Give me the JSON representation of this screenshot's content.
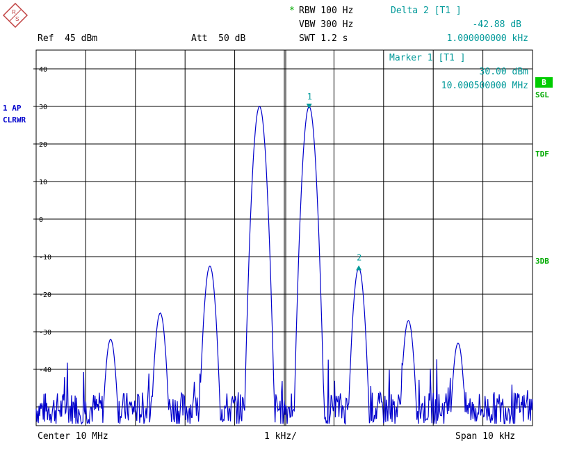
{
  "header": {
    "rbw_star": "*",
    "rbw": "RBW 100 Hz",
    "vbw": "VBW 300 Hz",
    "swt": "SWT 1.2 s",
    "ref": "Ref  45 dBm",
    "att": "Att  50 dB",
    "delta_title": "Delta 2 [T1 ]",
    "delta_value": "-42.88 dB",
    "delta_freq": "1.000000000 kHz",
    "marker_title": "Marker 1 [T1 ]",
    "marker_value": "30.00 dBm",
    "marker_freq": "10.000500000 MHz"
  },
  "side": {
    "trace_id": "1 AP",
    "trace_mode": "CLRWR",
    "badge": "B",
    "sgl": "SGL",
    "tdf": "TDF",
    "db3": "3DB"
  },
  "footer": {
    "center": "Center 10 MHz",
    "div": "1 kHz/",
    "span": "Span 10 kHz"
  },
  "colors": {
    "trace": "#0000cc",
    "marker": "#009999",
    "status": "#00cc00"
  },
  "chart_data": {
    "type": "line",
    "title": "",
    "xlabel": "",
    "ylabel": "",
    "xlim": [
      -5,
      5
    ],
    "ylim": [
      -55,
      45
    ],
    "x_unit": "kHz offset from center",
    "y_unit": "dBm",
    "grid": true,
    "yticks": [
      40,
      30,
      20,
      10,
      0,
      -10,
      -20,
      -30,
      -40
    ],
    "ytick_labels": [
      "40",
      "30",
      "20",
      "10",
      "0",
      "-10",
      "-20",
      "-30",
      "-40"
    ],
    "noise_floor": -52,
    "series": [
      {
        "peaks": [
          {
            "x": -3.5,
            "y": -32
          },
          {
            "x": -2.5,
            "y": -25
          },
          {
            "x": -1.5,
            "y": -12.5
          },
          {
            "x": -0.5,
            "y": 30
          },
          {
            "x": 0.5,
            "y": 30
          },
          {
            "x": 1.5,
            "y": -13
          },
          {
            "x": 2.5,
            "y": -27
          },
          {
            "x": 3.5,
            "y": -33
          }
        ]
      }
    ],
    "markers": [
      {
        "label": "1",
        "x": 0.5,
        "y": 30
      },
      {
        "label": "2",
        "x": 1.5,
        "y": -12.88
      }
    ]
  }
}
